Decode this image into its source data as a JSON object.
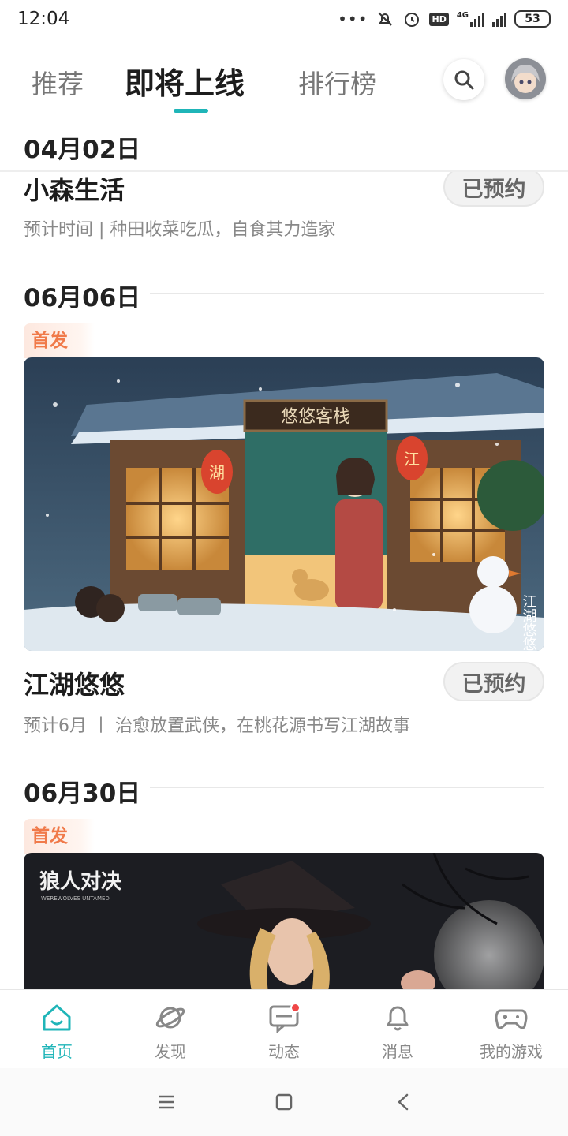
{
  "status": {
    "time": "12:04",
    "battery": "53",
    "network": "4G",
    "hd": "HD"
  },
  "tabs": [
    {
      "label": "推荐",
      "active": false
    },
    {
      "label": "即将上线",
      "active": true
    },
    {
      "label": "排行榜",
      "active": false
    }
  ],
  "sections": [
    {
      "date": "04月02日",
      "games": [
        {
          "title": "小森生活",
          "desc": "预计时间 | 种田收菜吃瓜，自食其力造家",
          "button": "已预约"
        }
      ]
    },
    {
      "date": "06月06日",
      "tag": "首发",
      "games": [
        {
          "title": "江湖悠悠",
          "desc": "预计6月 丨 治愈放置武侠，在桃花源书写江湖故事",
          "button": "已预约",
          "banner_signs": [
            "悠悠客栈",
            "湖",
            "江"
          ],
          "banner_logo": "江湖悠悠"
        }
      ]
    },
    {
      "date": "06月30日",
      "tag": "首发",
      "games": [
        {
          "banner_logo": "狼人对决",
          "banner_sub": "WEREWOLVES UNTAMED"
        }
      ]
    }
  ],
  "bottom_nav": [
    {
      "label": "首页",
      "icon": "home-icon",
      "active": true
    },
    {
      "label": "发现",
      "icon": "planet-icon",
      "active": false
    },
    {
      "label": "动态",
      "icon": "chat-icon",
      "active": false,
      "badge": true
    },
    {
      "label": "消息",
      "icon": "bell-icon",
      "active": false
    },
    {
      "label": "我的游戏",
      "icon": "gamepad-icon",
      "active": false
    }
  ],
  "colors": {
    "accent": "#1fb5b8",
    "tag": "#f07a4a",
    "badge": "#f04747"
  }
}
